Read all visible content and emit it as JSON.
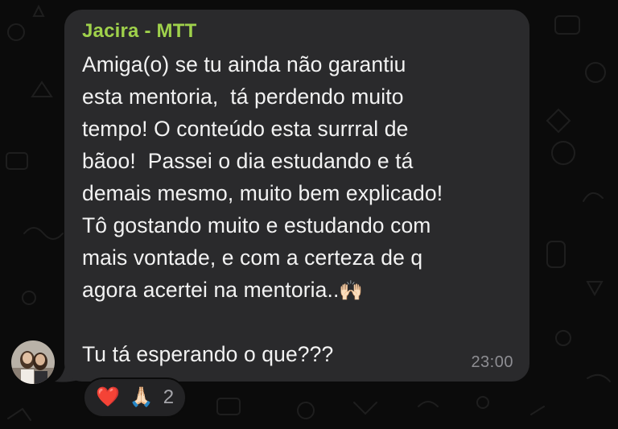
{
  "message": {
    "sender": "Jacira - MTT",
    "lines": [
      "Amiga(o) se tu ainda não garantiu",
      "esta mentoria,  tá perdendo muito",
      "tempo! O conteúdo esta surrral de",
      "bãoo!  Passei o dia estudando e tá",
      "demais mesmo, muito bem explicado!",
      "Tô gostando muito e estudando com",
      "mais vontade, e com a certeza de q",
      "agora acertei na mentoria..",
      "",
      "Tu tá esperando o que???"
    ],
    "inline_emoji": "🙌🏻",
    "time": "23:00"
  },
  "reactions": {
    "heart": "❤️",
    "pray": "🙏🏻",
    "count": "2"
  },
  "colors": {
    "sender": "#9fd14b",
    "bubble": "#2a2a2c",
    "background": "#0b0b0b",
    "time": "#8e8e93"
  },
  "icons": {
    "avatar": "avatar-photo",
    "wallpaper": "doodle-pattern"
  }
}
